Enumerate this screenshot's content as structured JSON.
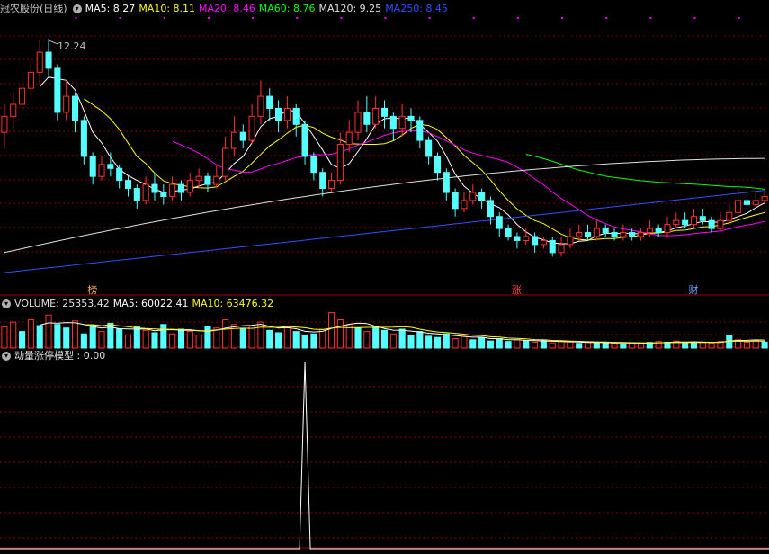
{
  "header": {
    "stock_name": "冠农股份(日线)",
    "ma": [
      {
        "label": "MA5: 8.27",
        "color": "#ffffff"
      },
      {
        "label": "MA10: 8.11",
        "color": "#ffff00"
      },
      {
        "label": "MA20: 8.46",
        "color": "#ff00ff"
      },
      {
        "label": "MA60: 8.76",
        "color": "#00ff00"
      },
      {
        "label": "MA120: 9.25",
        "color": "#e0e0e0"
      },
      {
        "label": "MA250: 8.45",
        "color": "#3050ff"
      }
    ]
  },
  "volume_header": {
    "volume": "VOLUME: 25353.42",
    "ma5": "MA5: 60022.41",
    "ma10": "MA10: 63476.32"
  },
  "indicator_header": {
    "name": "动量涨停模型 : 0.00"
  },
  "colors": {
    "up": "#ff3030",
    "down": "#54ffff",
    "grid": "#8b0000",
    "panel_border": "#a00000"
  },
  "chart_data": [
    {
      "type": "candlestick",
      "title": "冠农股份(日线)",
      "ylim": [
        6.2,
        12.8
      ],
      "max_label": "12.24",
      "event_markers": [
        {
          "label": "榜",
          "index": 10,
          "color": "#ffb040"
        },
        {
          "label": "涨",
          "index": 58,
          "color": "#ff4040"
        },
        {
          "label": "财",
          "index": 78,
          "color": "#60a0ff"
        }
      ],
      "candles": [
        [
          9.9,
          10.3,
          10.6,
          9.5
        ],
        [
          10.3,
          10.6,
          10.9,
          10.0
        ],
        [
          10.6,
          11.0,
          11.3,
          10.4
        ],
        [
          11.0,
          11.4,
          11.7,
          10.8
        ],
        [
          11.4,
          11.9,
          12.2,
          11.1
        ],
        [
          11.9,
          11.5,
          12.24,
          11.3
        ],
        [
          11.5,
          10.4,
          11.6,
          10.2
        ],
        [
          10.4,
          10.8,
          11.2,
          10.2
        ],
        [
          10.8,
          10.2,
          10.9,
          9.9
        ],
        [
          10.2,
          9.3,
          10.3,
          9.1
        ],
        [
          9.3,
          8.8,
          9.4,
          8.6
        ],
        [
          8.8,
          9.1,
          9.3,
          8.7
        ],
        [
          9.1,
          9.0,
          9.4,
          8.8
        ],
        [
          9.0,
          8.7,
          9.1,
          8.5
        ],
        [
          8.7,
          8.5,
          8.8,
          8.3
        ],
        [
          8.5,
          8.2,
          8.6,
          8.0
        ],
        [
          8.2,
          8.6,
          8.8,
          8.1
        ],
        [
          8.6,
          8.4,
          8.9,
          8.2
        ],
        [
          8.4,
          8.3,
          8.6,
          8.1
        ],
        [
          8.3,
          8.6,
          8.8,
          8.2
        ],
        [
          8.6,
          8.4,
          8.7,
          8.2
        ],
        [
          8.4,
          8.7,
          8.9,
          8.3
        ],
        [
          8.7,
          8.8,
          9.0,
          8.5
        ],
        [
          8.8,
          8.6,
          8.9,
          8.4
        ],
        [
          8.6,
          8.8,
          9.1,
          8.5
        ],
        [
          8.8,
          9.5,
          9.8,
          8.7
        ],
        [
          9.5,
          9.9,
          10.3,
          9.3
        ],
        [
          9.9,
          9.7,
          10.1,
          9.5
        ],
        [
          9.7,
          10.3,
          10.6,
          9.6
        ],
        [
          10.3,
          10.8,
          11.2,
          10.1
        ],
        [
          10.8,
          10.5,
          11.0,
          10.2
        ],
        [
          10.5,
          10.2,
          10.7,
          9.9
        ],
        [
          10.2,
          10.5,
          10.8,
          10.0
        ],
        [
          10.5,
          10.1,
          10.6,
          9.8
        ],
        [
          10.1,
          9.3,
          10.2,
          9.1
        ],
        [
          9.3,
          8.9,
          9.4,
          8.7
        ],
        [
          8.9,
          8.5,
          9.0,
          8.3
        ],
        [
          8.5,
          8.7,
          8.9,
          8.4
        ],
        [
          8.7,
          9.6,
          9.9,
          8.6
        ],
        [
          9.6,
          9.9,
          10.2,
          9.4
        ],
        [
          9.9,
          10.4,
          10.7,
          9.7
        ],
        [
          10.4,
          10.1,
          10.8,
          9.9
        ],
        [
          10.1,
          10.5,
          10.8,
          10.0
        ],
        [
          10.5,
          10.3,
          10.7,
          10.0
        ],
        [
          10.3,
          10.0,
          10.4,
          9.7
        ],
        [
          10.0,
          10.3,
          10.6,
          9.8
        ],
        [
          10.3,
          10.2,
          10.5,
          9.9
        ],
        [
          10.2,
          9.7,
          10.3,
          9.5
        ],
        [
          9.7,
          9.3,
          9.8,
          9.1
        ],
        [
          9.3,
          8.9,
          9.4,
          8.7
        ],
        [
          8.9,
          8.4,
          9.0,
          8.2
        ],
        [
          8.4,
          8.0,
          8.5,
          7.8
        ],
        [
          8.0,
          8.2,
          8.4,
          7.9
        ],
        [
          8.2,
          8.4,
          8.6,
          8.1
        ],
        [
          8.4,
          8.2,
          8.5,
          8.0
        ],
        [
          8.2,
          7.8,
          8.3,
          7.6
        ],
        [
          7.8,
          7.5,
          7.9,
          7.3
        ],
        [
          7.5,
          7.3,
          7.6,
          7.2
        ],
        [
          7.3,
          7.2,
          7.4,
          7.0
        ],
        [
          7.2,
          7.3,
          7.5,
          7.1
        ],
        [
          7.3,
          7.1,
          7.4,
          6.9
        ],
        [
          7.1,
          7.2,
          7.3,
          7.0
        ],
        [
          7.2,
          6.9,
          7.3,
          6.8
        ],
        [
          6.9,
          7.1,
          7.3,
          6.8
        ],
        [
          7.1,
          7.3,
          7.5,
          7.0
        ],
        [
          7.3,
          7.4,
          7.6,
          7.2
        ],
        [
          7.4,
          7.3,
          7.6,
          7.2
        ],
        [
          7.3,
          7.5,
          7.7,
          7.2
        ],
        [
          7.5,
          7.4,
          7.6,
          7.3
        ],
        [
          7.4,
          7.3,
          7.5,
          7.2
        ],
        [
          7.3,
          7.4,
          7.6,
          7.2
        ],
        [
          7.4,
          7.3,
          7.5,
          7.2
        ],
        [
          7.3,
          7.4,
          7.5,
          7.2
        ],
        [
          7.4,
          7.5,
          7.7,
          7.3
        ],
        [
          7.5,
          7.4,
          7.6,
          7.3
        ],
        [
          7.4,
          7.6,
          7.8,
          7.3
        ],
        [
          7.6,
          7.7,
          7.9,
          7.5
        ],
        [
          7.7,
          7.6,
          7.9,
          7.5
        ],
        [
          7.6,
          7.8,
          8.0,
          7.5
        ],
        [
          7.8,
          7.7,
          8.0,
          7.6
        ],
        [
          7.7,
          7.5,
          7.8,
          7.4
        ],
        [
          7.5,
          7.7,
          7.9,
          7.4
        ],
        [
          7.7,
          7.9,
          8.1,
          7.6
        ],
        [
          7.9,
          8.2,
          8.5,
          7.8
        ],
        [
          8.2,
          8.1,
          8.4,
          8.0
        ],
        [
          8.1,
          8.2,
          8.4,
          8.0
        ],
        [
          8.2,
          8.3,
          8.4,
          8.1
        ]
      ]
    },
    {
      "type": "bar",
      "title": "VOLUME",
      "ylim": [
        0,
        160000
      ],
      "values": [
        90000,
        110000,
        70000,
        120000,
        95000,
        140000,
        100000,
        85000,
        115000,
        60000,
        95000,
        70000,
        105000,
        80000,
        55000,
        90000,
        75000,
        65000,
        100000,
        60000,
        80000,
        70000,
        55000,
        90000,
        85000,
        120000,
        100000,
        80000,
        95000,
        110000,
        75000,
        65000,
        90000,
        70000,
        55000,
        60000,
        80000,
        150000,
        120000,
        95000,
        85000,
        70000,
        90000,
        75000,
        60000,
        80000,
        55000,
        70000,
        50000,
        45000,
        60000,
        40000,
        50000,
        35000,
        45000,
        30000,
        40000,
        28000,
        35000,
        30000,
        25000,
        32000,
        22000,
        28000,
        26000,
        20000,
        24000,
        22000,
        25000,
        20000,
        18000,
        22000,
        20000,
        24000,
        28000,
        25000,
        30000,
        22000,
        26000,
        24000,
        20000,
        28000,
        55000,
        35000,
        25000,
        30000,
        25353
      ],
      "colors_up": [
        1,
        1,
        0,
        1,
        0,
        1,
        0,
        0,
        1,
        0,
        0,
        1,
        0,
        0,
        1,
        0,
        1,
        0,
        0,
        1,
        0,
        1,
        1,
        0,
        1,
        1,
        1,
        0,
        1,
        1,
        0,
        0,
        1,
        0,
        0,
        0,
        1,
        1,
        1,
        1,
        0,
        1,
        0,
        0,
        1,
        0,
        0,
        0,
        0,
        0,
        0,
        1,
        1,
        0,
        0,
        0,
        0,
        0,
        1,
        0,
        1,
        0,
        1,
        1,
        1,
        0,
        1,
        0,
        0,
        1,
        0,
        1,
        1,
        0,
        1,
        0,
        1,
        0,
        0,
        1,
        1,
        1,
        0,
        1,
        1,
        1,
        0
      ],
      "ma5_label": "MA5: 60022.41",
      "ma10_label": "MA10: 63476.32"
    },
    {
      "type": "line",
      "title": "动量涨停模型",
      "ylim": [
        0,
        1
      ],
      "spike_index": 34
    }
  ]
}
